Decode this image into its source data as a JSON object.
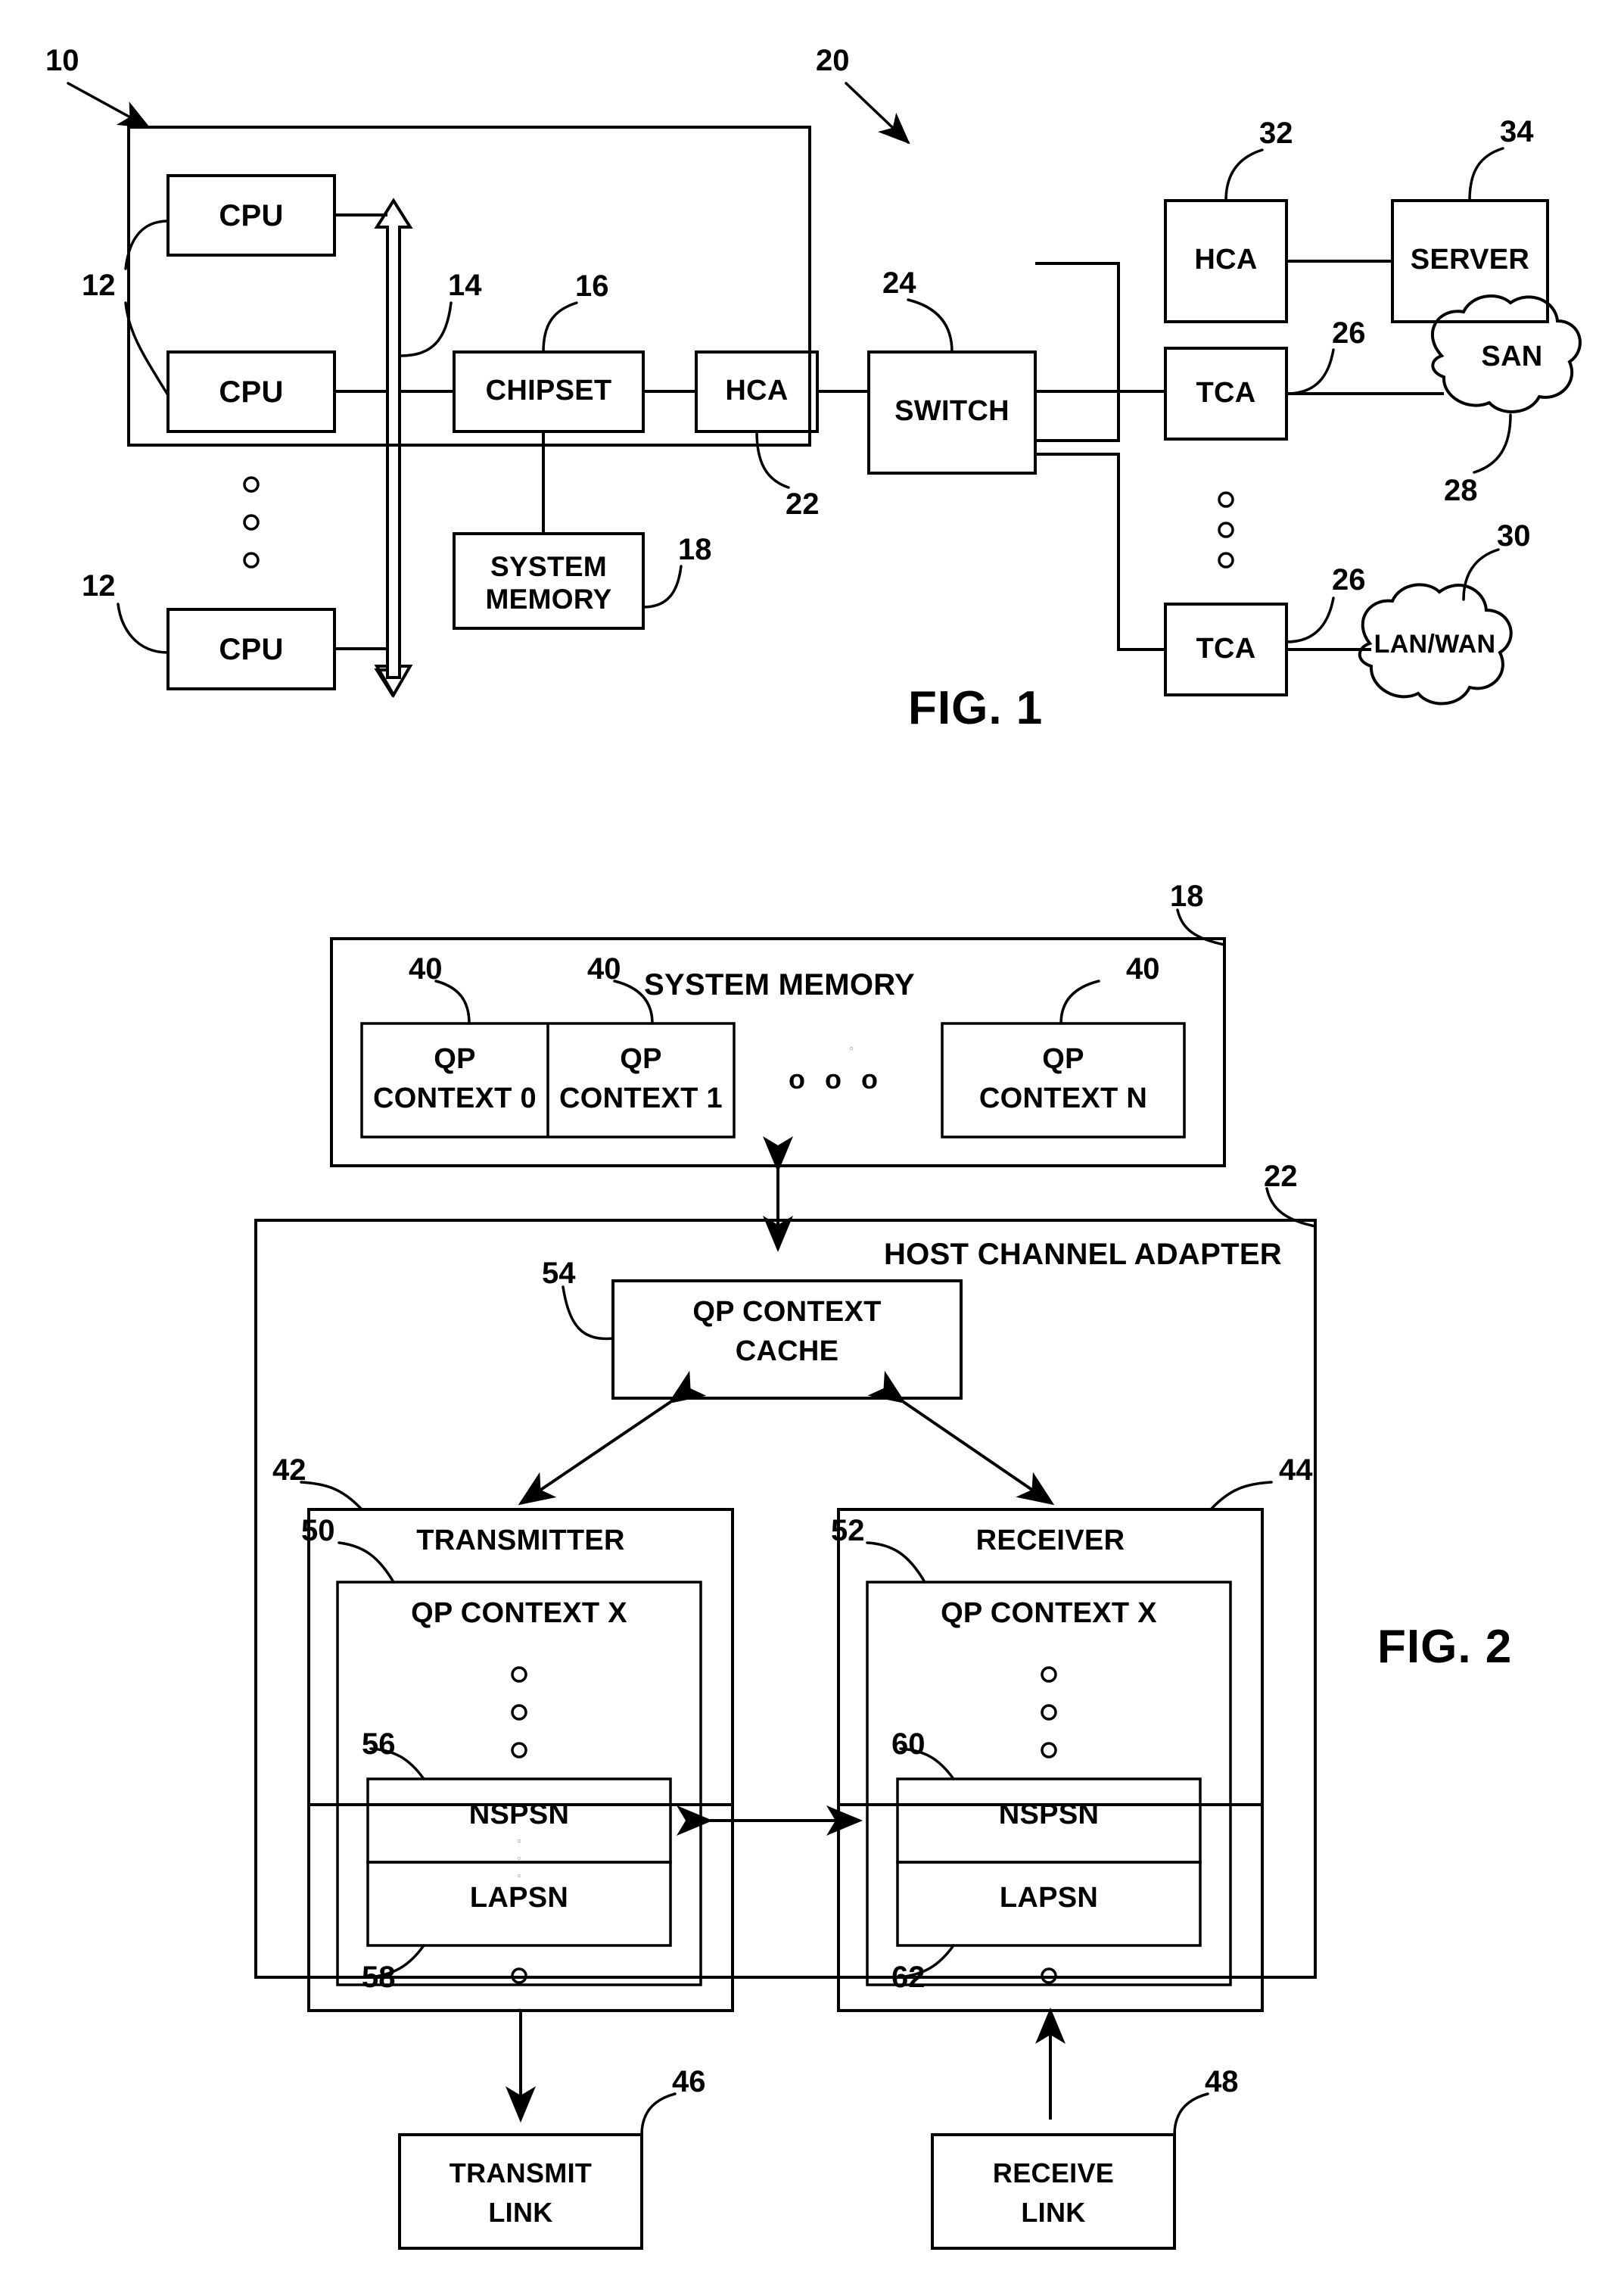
{
  "document": {
    "type": "patent-drawing-sheet",
    "figures": [
      "FIG. 1",
      "FIG. 2"
    ]
  },
  "fig1": {
    "caption": "FIG. 1",
    "boxes": {
      "cpu1": "CPU",
      "cpu2": "CPU",
      "cpu3": "CPU",
      "chipset": "CHIPSET",
      "system_memory": "SYSTEM\nMEMORY",
      "hca_host": "HCA",
      "switch": "SWITCH",
      "hca_remote": "HCA",
      "server": "SERVER",
      "tca1": "TCA",
      "tca2": "TCA"
    },
    "clouds": {
      "san": "SAN",
      "lanwan": "LAN/WAN"
    },
    "reference_numerals": {
      "host_system": "10",
      "cpu_group_top": "12",
      "cpu_group_bottom": "12",
      "bus": "14",
      "chipset": "16",
      "system_memory": "18",
      "fabric": "20",
      "hca_host": "22",
      "switch": "24",
      "tca_top": "26",
      "tca_bottom": "26",
      "san": "28",
      "lanwan": "30",
      "hca_remote": "32",
      "server": "34"
    }
  },
  "fig2": {
    "caption": "FIG. 2",
    "system_memory": {
      "title": "SYSTEM MEMORY",
      "numeral": "18",
      "qp_contexts": [
        {
          "line1": "QP",
          "line2": "CONTEXT 0",
          "numeral": "40"
        },
        {
          "line1": "QP",
          "line2": "CONTEXT 1",
          "numeral": "40"
        },
        {
          "line1": "QP",
          "line2": "CONTEXT N",
          "numeral": "40"
        }
      ],
      "ellipsis": "o o o"
    },
    "hca": {
      "title": "HOST CHANNEL ADAPTER",
      "numeral": "22",
      "cache": {
        "line1": "QP CONTEXT",
        "line2": "CACHE",
        "numeral": "54"
      },
      "transmitter": {
        "title": "TRANSMITTER",
        "numeral": "42",
        "context": {
          "title": "QP CONTEXT X",
          "numeral": "50"
        },
        "fields": [
          {
            "label": "NSPSN",
            "numeral": "56"
          },
          {
            "label": "LAPSN",
            "numeral": "58"
          }
        ]
      },
      "receiver": {
        "title": "RECEIVER",
        "numeral": "44",
        "context": {
          "title": "QP CONTEXT X",
          "numeral": "52"
        },
        "fields": [
          {
            "label": "NSPSN",
            "numeral": "60"
          },
          {
            "label": "LAPSN",
            "numeral": "62"
          }
        ]
      }
    },
    "links": {
      "transmit": {
        "line1": "TRANSMIT",
        "line2": "LINK",
        "numeral": "46"
      },
      "receive": {
        "line1": "RECEIVE",
        "line2": "LINK",
        "numeral": "48"
      }
    }
  },
  "colors": {
    "ink": "#000000",
    "paper": "#ffffff"
  }
}
